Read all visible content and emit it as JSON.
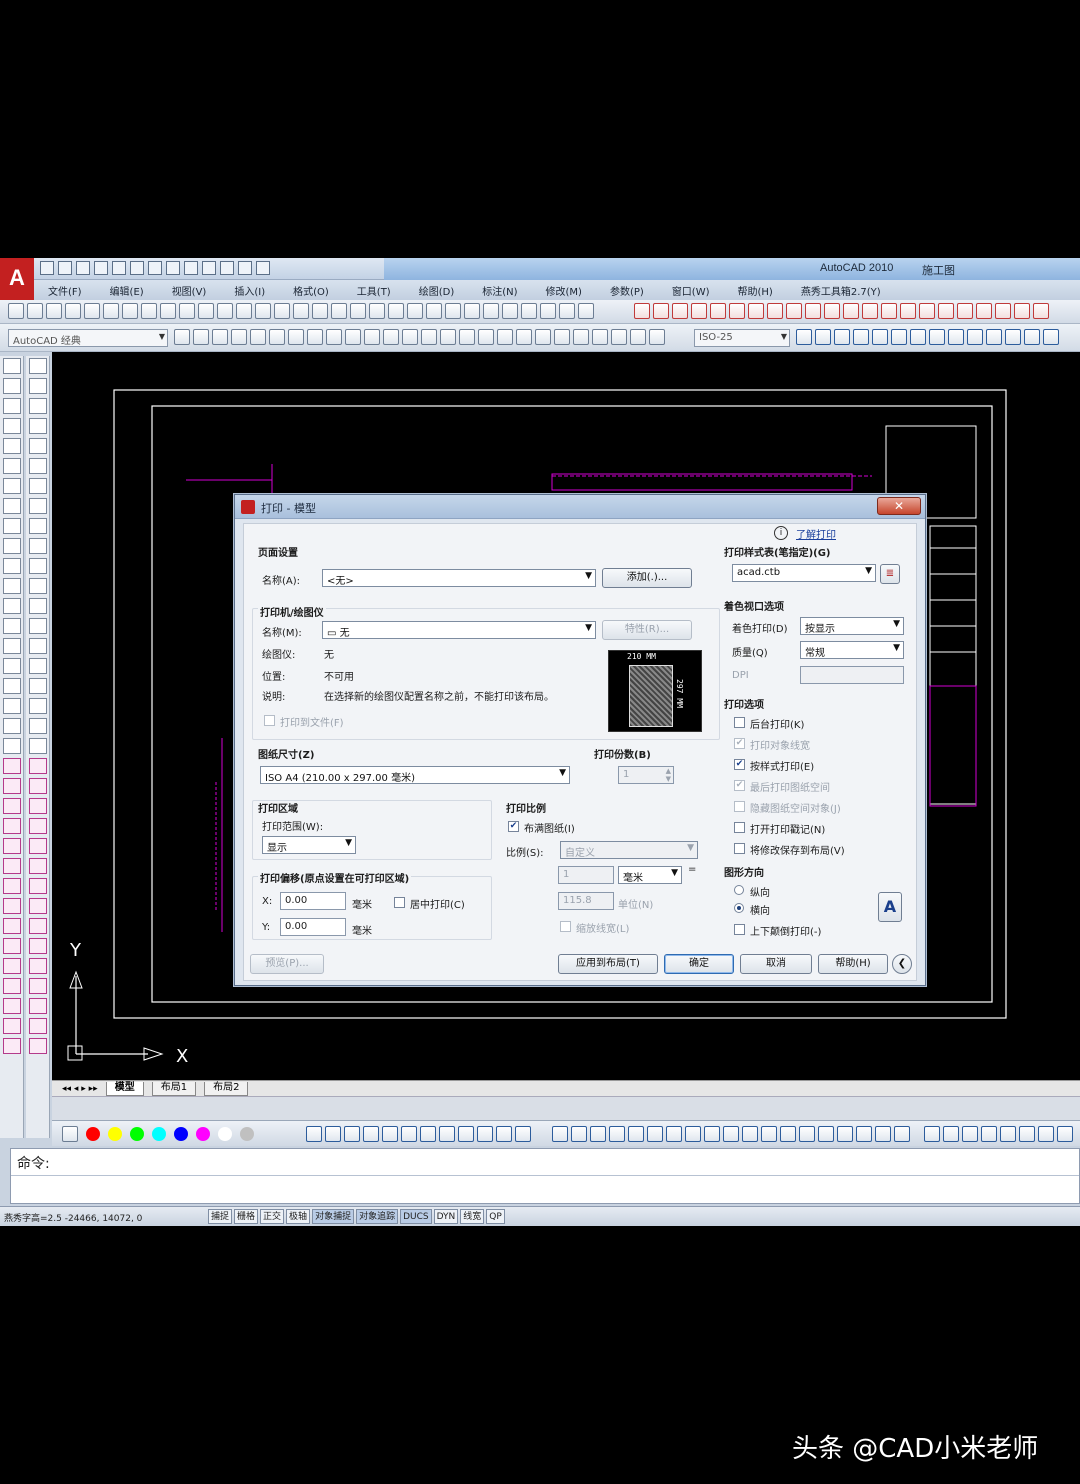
{
  "app": {
    "title": "AutoCAD 2010",
    "file_name": "施工图",
    "logo_letter": "A"
  },
  "menu": [
    "文件(F)",
    "编辑(E)",
    "视图(V)",
    "插入(I)",
    "格式(O)",
    "工具(T)",
    "绘图(D)",
    "标注(N)",
    "修改(M)",
    "参数(P)",
    "窗口(W)",
    "帮助(H)",
    "燕秀工具箱2.7(Y)"
  ],
  "toolbars": {
    "workspace": "AutoCAD 经典",
    "dim_style": "ISO-25"
  },
  "drawing": {
    "ucs_x": "X",
    "ucs_y": "Y"
  },
  "layout_tabs": [
    "模型",
    "布局1",
    "布局2"
  ],
  "command": {
    "prompt": "命令:"
  },
  "status": {
    "coords": "燕秀字高=2.5  -24466, 14072, 0",
    "buttons": [
      {
        "label": "捕捉",
        "on": false
      },
      {
        "label": "栅格",
        "on": false
      },
      {
        "label": "正交",
        "on": false
      },
      {
        "label": "极轴",
        "on": false
      },
      {
        "label": "对象捕捉",
        "on": true
      },
      {
        "label": "对象追踪",
        "on": true
      },
      {
        "label": "DUCS",
        "on": true
      },
      {
        "label": "DYN",
        "on": false
      },
      {
        "label": "线宽",
        "on": false
      },
      {
        "label": "QP",
        "on": false
      }
    ]
  },
  "colors": {
    "accent": "#2f6bb1",
    "drawing_bg": "#000000",
    "cad_magenta": "#d400d4",
    "cad_white": "#ffffff",
    "palette_swatches": [
      "#ff0000",
      "#ffff00",
      "#00ff00",
      "#00ffff",
      "#0000ff",
      "#ff00ff",
      "#ffffff",
      "#c0c0c0"
    ]
  },
  "dialog": {
    "title": "打印 - 模型",
    "close": "✕",
    "help_link": "了解打印",
    "page_setup": {
      "title": "页面设置",
      "name_label": "名称(A):",
      "name_value": "<无>",
      "add_button": "添加(.)..."
    },
    "printer": {
      "title": "打印机/绘图仪",
      "name_label": "名称(M):",
      "name_value": "无",
      "props_button": "特性(R)...",
      "plotter_label": "绘图仪:",
      "plotter_value": "无",
      "location_label": "位置:",
      "location_value": "不可用",
      "desc_label": "说明:",
      "desc_value": "在选择新的绘图仪配置名称之前，不能打印该布局。",
      "print_to_file": "打印到文件(F)",
      "paper_w": "210 MM",
      "paper_h": "297 MM"
    },
    "paper_size": {
      "title": "图纸尺寸(Z)",
      "value": "ISO A4 (210.00 x 297.00 毫米)"
    },
    "copies": {
      "title": "打印份数(B)",
      "value": "1"
    },
    "plot_area": {
      "title": "打印区域",
      "range_label": "打印范围(W):",
      "range_value": "显示"
    },
    "plot_offset": {
      "title": "打印偏移(原点设置在可打印区域)",
      "x_label": "X:",
      "x_value": "0.00",
      "y_label": "Y:",
      "y_value": "0.00",
      "unit": "毫米",
      "center": "居中打印(C)"
    },
    "plot_scale": {
      "title": "打印比例",
      "fit": "布满图纸(I)",
      "fit_checked": true,
      "scale_label": "比例(S):",
      "scale_value": "自定义",
      "value1": "1",
      "unit": "毫米",
      "equals": "=",
      "value2": "115.8",
      "unit2": "单位(N)",
      "lineweights": "缩放线宽(L)"
    },
    "plot_style": {
      "title": "打印样式表(笔指定)(G)",
      "value": "acad.ctb"
    },
    "shaded": {
      "title": "着色视口选项",
      "shade_label": "着色打印(D)",
      "shade_value": "按显示",
      "quality_label": "质量(Q)",
      "quality_value": "常规",
      "dpi_label": "DPI"
    },
    "plot_options": {
      "title": "打印选项",
      "items": [
        {
          "label": "后台打印(K)",
          "checked": false,
          "enabled": true
        },
        {
          "label": "打印对象线宽",
          "checked": true,
          "enabled": false
        },
        {
          "label": "按样式打印(E)",
          "checked": true,
          "enabled": true
        },
        {
          "label": "最后打印图纸空间",
          "checked": true,
          "enabled": false
        },
        {
          "label": "隐藏图纸空间对象(J)",
          "checked": false,
          "enabled": false
        },
        {
          "label": "打开打印戳记(N)",
          "checked": false,
          "enabled": true
        },
        {
          "label": "将修改保存到布局(V)",
          "checked": false,
          "enabled": true
        }
      ]
    },
    "orientation": {
      "title": "图形方向",
      "portrait": "纵向",
      "landscape": "横向",
      "upside": "上下颠倒打印(-)"
    },
    "footer": {
      "preview": "预览(P)...",
      "apply": "应用到布局(T)",
      "ok": "确定",
      "cancel": "取消",
      "help": "帮助(H)"
    }
  },
  "watermark": "头条 @CAD小米老师"
}
